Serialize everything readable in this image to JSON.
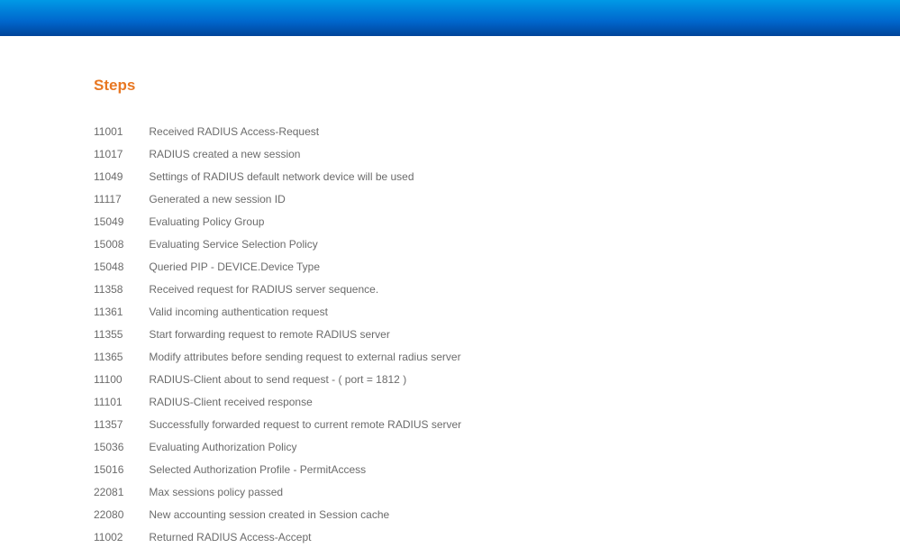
{
  "heading": "Steps",
  "steps": [
    {
      "code": "11001",
      "description": "Received RADIUS Access-Request"
    },
    {
      "code": "11017",
      "description": "RADIUS created a new session"
    },
    {
      "code": "11049",
      "description": "Settings of RADIUS default network device will be used"
    },
    {
      "code": "11117",
      "description": "Generated a new session ID"
    },
    {
      "code": "15049",
      "description": "Evaluating Policy Group"
    },
    {
      "code": "15008",
      "description": "Evaluating Service Selection Policy"
    },
    {
      "code": "15048",
      "description": "Queried PIP - DEVICE.Device Type"
    },
    {
      "code": "11358",
      "description": "Received request for RADIUS server sequence."
    },
    {
      "code": "11361",
      "description": "Valid incoming authentication request"
    },
    {
      "code": "11355",
      "description": "Start forwarding request to remote RADIUS server"
    },
    {
      "code": "11365",
      "description": "Modify attributes before sending request to external radius server"
    },
    {
      "code": "11100",
      "description": "RADIUS-Client about to send request - ( port = 1812 )"
    },
    {
      "code": "11101",
      "description": "RADIUS-Client received response"
    },
    {
      "code": "11357",
      "description": "Successfully forwarded request to current remote RADIUS server"
    },
    {
      "code": "15036",
      "description": "Evaluating Authorization Policy"
    },
    {
      "code": "15016",
      "description": "Selected Authorization Profile - PermitAccess"
    },
    {
      "code": "22081",
      "description": "Max sessions policy passed"
    },
    {
      "code": "22080",
      "description": "New accounting session created in Session cache"
    },
    {
      "code": "11002",
      "description": "Returned RADIUS Access-Accept"
    }
  ]
}
